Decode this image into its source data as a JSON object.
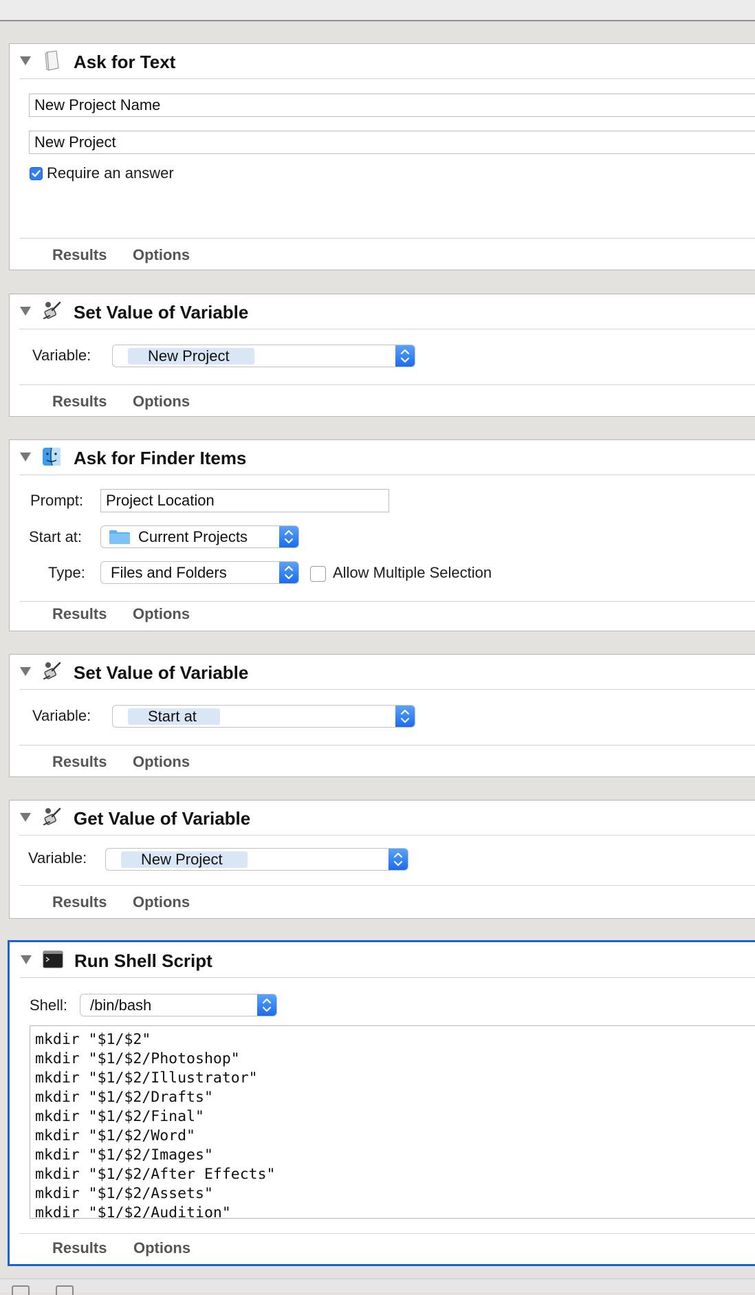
{
  "actions": [
    {
      "title": "Ask for Text",
      "icon": "text-document-icon",
      "question": "New Project Name",
      "default_answer": "New Project",
      "require_answer_label": "Require an answer",
      "require_answer_checked": true,
      "tabs": [
        "Results",
        "Options"
      ]
    },
    {
      "title": "Set Value of Variable",
      "icon": "variable-wand-icon",
      "variable_label": "Variable:",
      "variable_value": "New Project",
      "tabs": [
        "Results",
        "Options"
      ]
    },
    {
      "title": "Ask for Finder Items",
      "icon": "finder-icon",
      "prompt_label": "Prompt:",
      "prompt_value": "Project Location",
      "start_at_label": "Start at:",
      "start_at_value": "Current Projects",
      "type_label": "Type:",
      "type_value": "Files and Folders",
      "allow_multiple_label": "Allow Multiple Selection",
      "allow_multiple_checked": false,
      "tabs": [
        "Results",
        "Options"
      ]
    },
    {
      "title": "Set Value of Variable",
      "icon": "variable-wand-icon",
      "variable_label": "Variable:",
      "variable_value": "Start at",
      "tabs": [
        "Results",
        "Options"
      ]
    },
    {
      "title": "Get Value of Variable",
      "icon": "variable-wand-icon",
      "variable_label": "Variable:",
      "variable_value": "New Project",
      "tabs": [
        "Results",
        "Options"
      ]
    },
    {
      "title": "Run Shell Script",
      "icon": "terminal-icon",
      "shell_label": "Shell:",
      "shell_value": "/bin/bash",
      "script_lines": [
        "mkdir \"$1/$2\"",
        "mkdir \"$1/$2/Photoshop\"",
        "mkdir \"$1/$2/Illustrator\"",
        "mkdir \"$1/$2/Drafts\"",
        "mkdir \"$1/$2/Final\"",
        "mkdir \"$1/$2/Word\"",
        "mkdir \"$1/$2/Images\"",
        "mkdir \"$1/$2/After Effects\"",
        "mkdir \"$1/$2/Assets\"",
        "mkdir \"$1/$2/Audition\""
      ],
      "tabs": [
        "Results",
        "Options"
      ],
      "selected": true
    }
  ],
  "colors": {
    "selection_border": "#1a64d2",
    "stepper_blue": "#1b6cf0",
    "token_background": "#d9e6f5"
  }
}
